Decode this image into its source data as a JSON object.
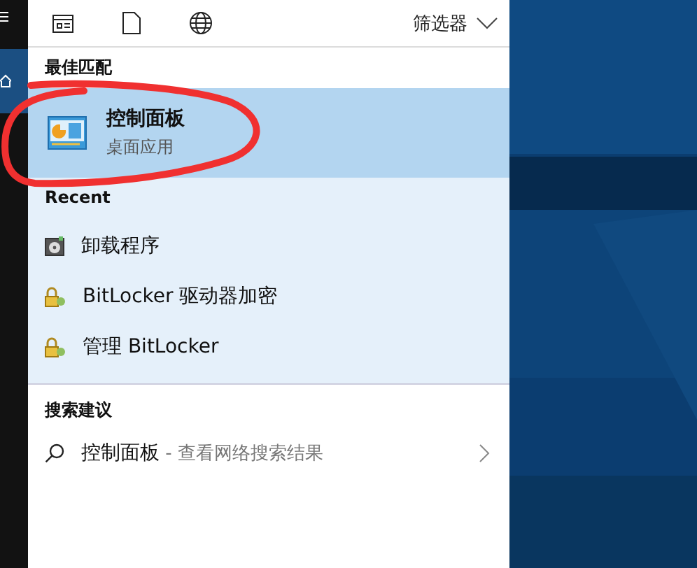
{
  "toolbar": {
    "filter_label": "筛选器"
  },
  "best_match": {
    "header": "最佳匹配",
    "title": "控制面板",
    "subtitle": "桌面应用",
    "selected": true
  },
  "recent": {
    "header": "Recent",
    "items": [
      {
        "label": "卸载程序",
        "kind": "disc"
      },
      {
        "label": "BitLocker 驱动器加密",
        "kind": "lock"
      },
      {
        "label": "管理 BitLocker",
        "kind": "lock"
      }
    ]
  },
  "suggestions": {
    "header": "搜索建议",
    "items": [
      {
        "query": "控制面板",
        "hint": " - 查看网络搜索结果"
      }
    ]
  }
}
